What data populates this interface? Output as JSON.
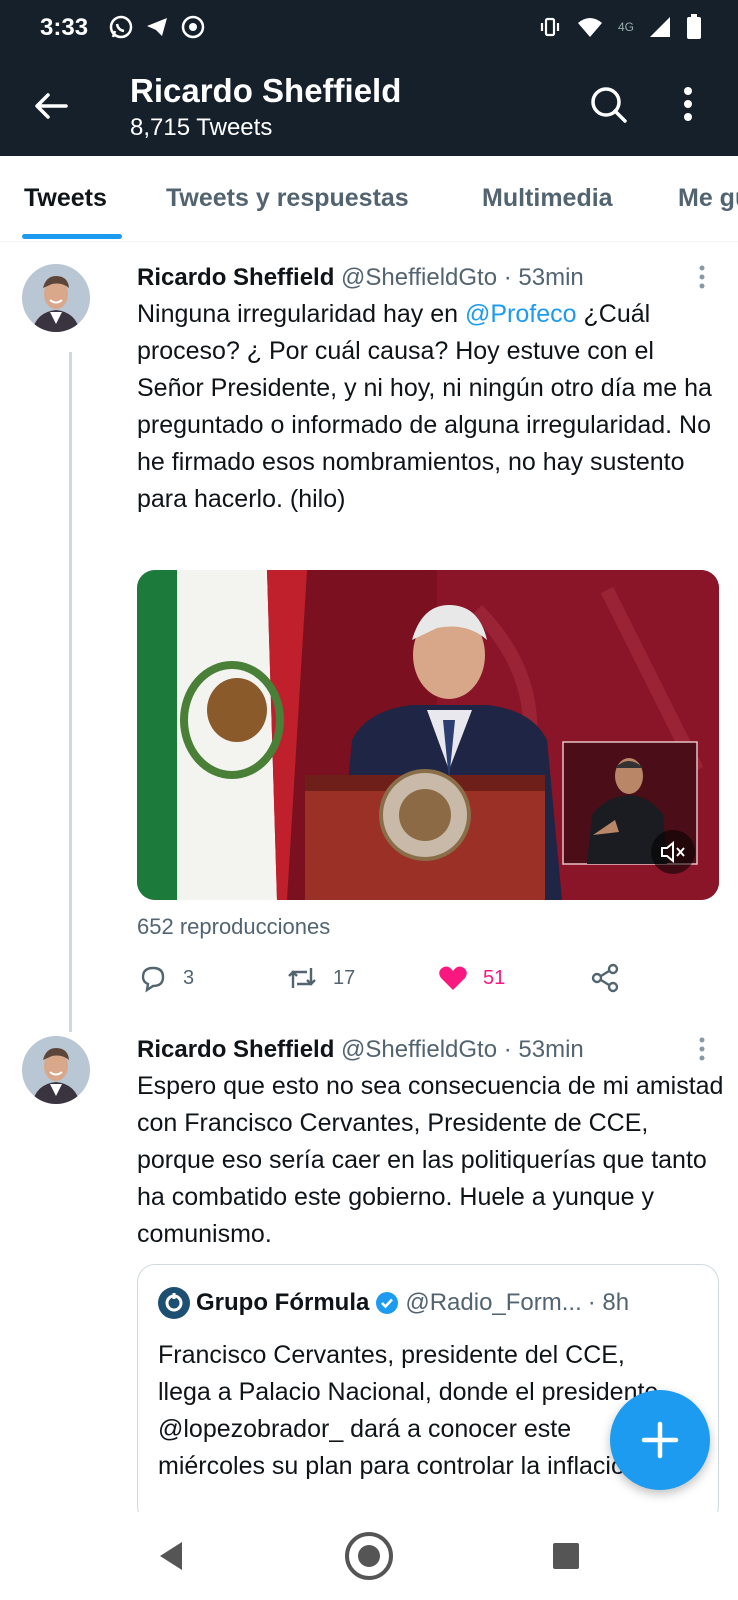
{
  "status_bar": {
    "time": "3:33",
    "network": "4G",
    "icons": [
      "whatsapp-icon",
      "telegram-icon",
      "settings-icon",
      "vibrate-icon",
      "wifi-icon",
      "signal-icon",
      "battery-icon"
    ]
  },
  "header": {
    "title": "Ricardo Sheffield",
    "subtitle": "8,715 Tweets"
  },
  "tabs": [
    {
      "label": "Tweets",
      "active": true
    },
    {
      "label": "Tweets y respuestas",
      "active": false
    },
    {
      "label": "Multimedia",
      "active": false
    },
    {
      "label": "Me gusta",
      "active": false
    }
  ],
  "tweets": [
    {
      "name": "Ricardo Sheffield",
      "handle": "@SheffieldGto",
      "time": "· 53min",
      "text_before": "Ninguna irregularidad  hay en ",
      "mention": "@Profeco",
      "text_after": " ¿Cuál proceso? ¿ Por cuál causa? Hoy estuve con el Señor Presidente, y ni hoy, ni ningún otro día me ha preguntado o informado de alguna irregularidad. No he firmado esos  nombramientos, no hay sustento para hacerlo. (hilo)",
      "views": "652 reproducciones",
      "replies": "3",
      "retweets": "17",
      "likes": "51"
    },
    {
      "name": "Ricardo Sheffield",
      "handle": "@SheffieldGto",
      "time": "· 53min",
      "text": "Espero que  esto no sea consecuencia de mi amistad con Francisco Cervantes, Presidente de CCE, porque eso sería caer en las politiquerías que tanto ha combatido este gobierno. Huele a yunque y comunismo."
    }
  ],
  "quoted_tweet": {
    "name": "Grupo Fórmula",
    "handle": "@Radio_Form...",
    "time": "· 8h",
    "text": "Francisco Cervantes, presidente del CCE, llega a Palacio Nacional, donde el presidente @lopezobrador_ dará a conocer este miércoles su plan para controlar la inflación. ..."
  },
  "colors": {
    "header_bg": "#15202b",
    "accent": "#1d9bf0",
    "like": "#f91880",
    "secondary_text": "#536471"
  }
}
